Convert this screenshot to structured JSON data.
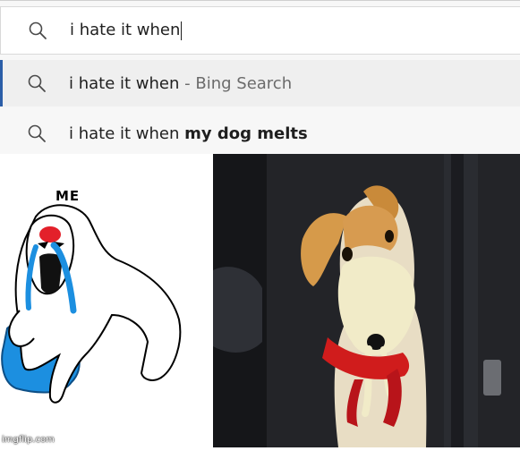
{
  "search": {
    "query": "i hate it when",
    "suggestions": [
      {
        "prefix": "i hate it when",
        "suffix": " - Bing Search"
      },
      {
        "prefix": "i hate it when ",
        "suffix": "my dog melts"
      }
    ]
  },
  "meme": {
    "label": "ME",
    "watermark": "imgflip.com"
  },
  "colors": {
    "accent_bar": "#2b5ea8",
    "puddle_blue": "#1c8fe0",
    "collar_red": "#d01c1c"
  }
}
